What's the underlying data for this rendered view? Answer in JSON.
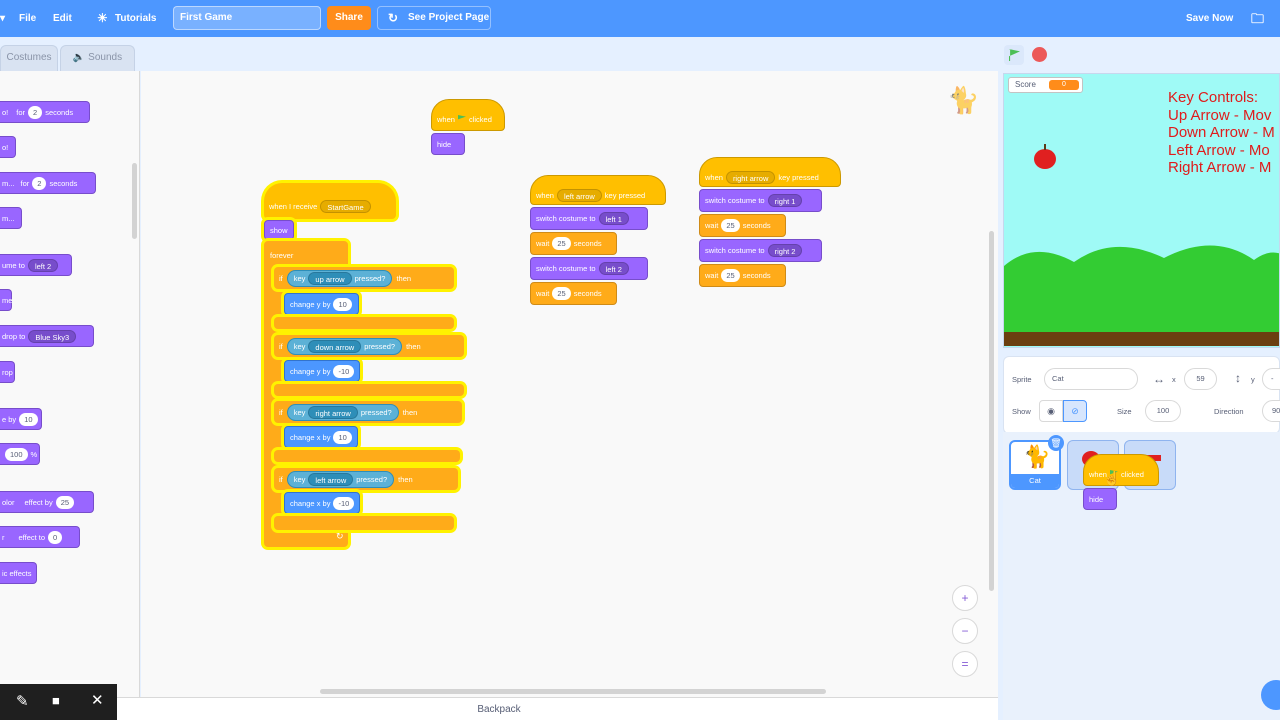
{
  "menu": {
    "file": "File",
    "edit": "Edit",
    "tutorials": "Tutorials",
    "project_title": "First Game",
    "share": "Share",
    "see_project_page": "See Project Page",
    "save_now": "Save Now"
  },
  "tabs": {
    "costumes": "Costumes",
    "sounds": "Sounds"
  },
  "palette": [
    {
      "a": "o!",
      "b": "for",
      "v": "2",
      "c": "seconds"
    },
    {
      "a": "o!"
    },
    {
      "a": "m...",
      "b": "for",
      "v": "2",
      "c": "seconds"
    },
    {
      "a": "m..."
    },
    {
      "a": "ume to",
      "d": "left 2"
    },
    {
      "a": "me"
    },
    {
      "a": "drop to",
      "d": "Blue Sky3"
    },
    {
      "a": "rop"
    },
    {
      "a": "e by",
      "v": "10"
    },
    {
      "a": "",
      "v": "100",
      "c": "%"
    },
    {
      "a": "olor",
      "b": "effect by",
      "v": "25"
    },
    {
      "a": "r",
      "b": "effect to",
      "v": "0"
    },
    {
      "a": "ic effects"
    }
  ],
  "scripts": {
    "flag_hide": {
      "when": "when",
      "clicked": "clicked",
      "hide": "hide"
    },
    "receive": {
      "when_receive": "when I receive",
      "message": "StartGame",
      "show": "show",
      "forever": "forever",
      "if": "if",
      "key": "key",
      "pressed": "pressed?",
      "then": "then",
      "up": "up arrow",
      "down": "down arrow",
      "right": "right arrow",
      "left": "left arrow",
      "change_y": "change y by",
      "change_x": "change x by",
      "v_up": "10",
      "v_down": "-10",
      "v_right": "10",
      "v_left": "-10"
    },
    "left_key": {
      "when": "when",
      "key": "left arrow",
      "key_pressed": "key pressed",
      "switch": "switch costume to",
      "c1": "left 1",
      "c2": "left 2",
      "wait": "wait",
      "w": "25",
      "seconds": "seconds"
    },
    "right_key": {
      "when": "when",
      "key": "right arrow",
      "key_pressed": "key pressed",
      "switch": "switch costume to",
      "c1": "right 1",
      "c2": "right 2",
      "wait": "wait",
      "w": "25",
      "seconds": "seconds"
    }
  },
  "backpack": "Backpack",
  "stage": {
    "score_label": "Score",
    "score_value": "0",
    "controls_lines": [
      "Key Controls:",
      "Up Arrow - Mov",
      "Down Arrow - M",
      "Left Arrow - Mo",
      "Right Arrow - M"
    ]
  },
  "sprite_info": {
    "sprite_label": "Sprite",
    "sprite_name": "Cat",
    "x_label": "x",
    "x": "59",
    "y_label": "y",
    "y": "-",
    "show_label": "Show",
    "size_label": "Size",
    "size": "100",
    "direction_label": "Direction",
    "direction": "90"
  },
  "sprites": [
    {
      "name": "Cat"
    }
  ],
  "drag_ghost": {
    "when": "when",
    "clicked": "clicked",
    "hide": "hide"
  },
  "colors": {
    "menu_bar": "#4d97ff",
    "events": "#ffbf00",
    "looks": "#9966ff",
    "control": "#ffab19",
    "motion": "#4c97ff",
    "sensing": "#5cb1d6",
    "controls_text": "#e01b1b"
  }
}
